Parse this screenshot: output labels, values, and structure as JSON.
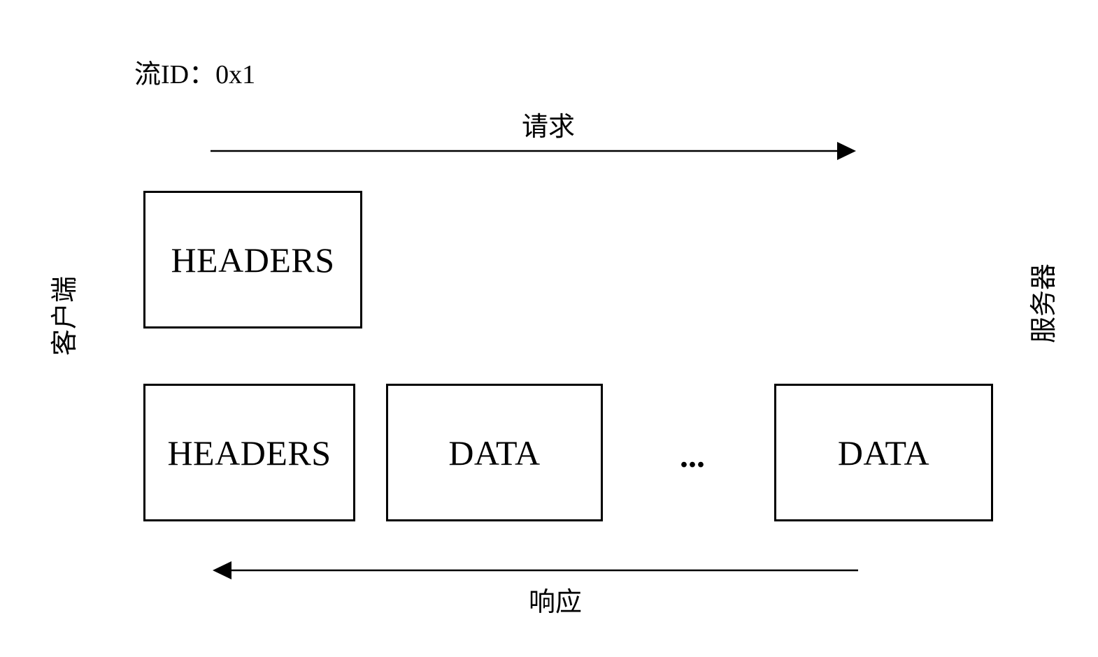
{
  "stream_id": "流ID：0x1",
  "endpoints": {
    "client": "客户端",
    "server": "服务器"
  },
  "arrows": {
    "request": "请求",
    "response": "响应"
  },
  "request_frames": [
    {
      "label": "HEADERS"
    }
  ],
  "response_frames": [
    {
      "label": "HEADERS"
    },
    {
      "label": "DATA"
    },
    {
      "label": "DATA"
    }
  ],
  "ellipsis": "..."
}
